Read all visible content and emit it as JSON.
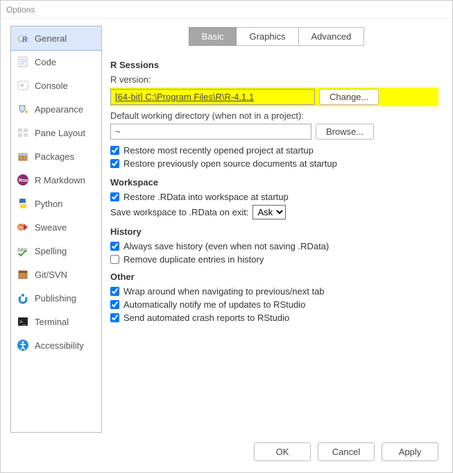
{
  "window": {
    "title": "Options"
  },
  "sidebar": {
    "items": [
      {
        "label": "General"
      },
      {
        "label": "Code"
      },
      {
        "label": "Console"
      },
      {
        "label": "Appearance"
      },
      {
        "label": "Pane Layout"
      },
      {
        "label": "Packages"
      },
      {
        "label": "R Markdown"
      },
      {
        "label": "Python"
      },
      {
        "label": "Sweave"
      },
      {
        "label": "Spelling"
      },
      {
        "label": "Git/SVN"
      },
      {
        "label": "Publishing"
      },
      {
        "label": "Terminal"
      },
      {
        "label": "Accessibility"
      }
    ]
  },
  "tabs": {
    "basic": "Basic",
    "graphics": "Graphics",
    "advanced": "Advanced"
  },
  "sections": {
    "rsessions": {
      "title": "R Sessions",
      "rversion_label": "R version:",
      "rversion_value": "[64-bit] C:\\Program Files\\R\\R-4.1.1",
      "change_btn": "Change...",
      "defaultdir_label": "Default working directory (when not in a project):",
      "defaultdir_value": "~",
      "browse_btn": "Browse...",
      "restore_project": "Restore most recently opened project at startup",
      "restore_docs": "Restore previously open source documents at startup"
    },
    "workspace": {
      "title": "Workspace",
      "restore_rdata": "Restore .RData into workspace at startup",
      "save_label": "Save workspace to .RData on exit:",
      "save_value": "Ask"
    },
    "history": {
      "title": "History",
      "always_save": "Always save history (even when not saving .RData)",
      "remove_dup": "Remove duplicate entries in history"
    },
    "other": {
      "title": "Other",
      "wrap": "Wrap around when navigating to previous/next tab",
      "notify": "Automatically notify me of updates to RStudio",
      "crash": "Send automated crash reports to RStudio"
    }
  },
  "footer": {
    "ok": "OK",
    "cancel": "Cancel",
    "apply": "Apply"
  }
}
